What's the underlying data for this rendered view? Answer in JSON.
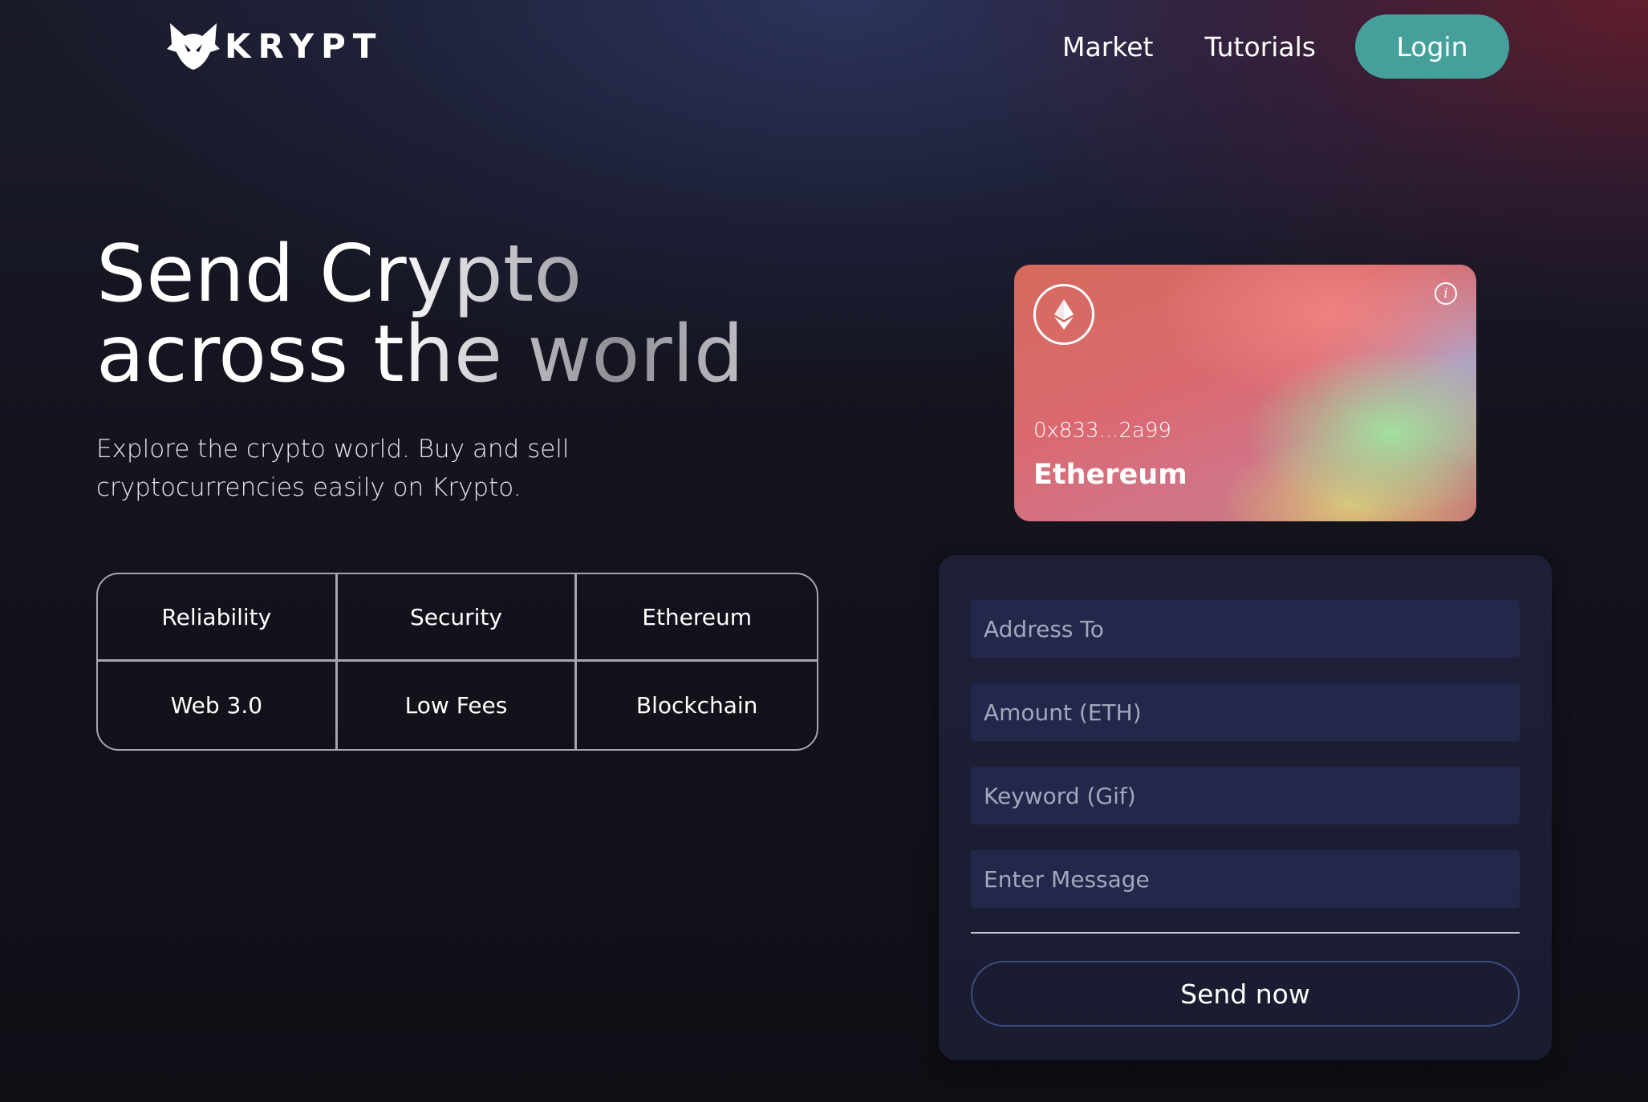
{
  "nav": {
    "logo_text": "KRYPT",
    "links": [
      "Market",
      "Tutorials"
    ],
    "login_label": "Login"
  },
  "hero": {
    "title_line1": "Send Crypto",
    "title_line2": "across the world",
    "subtitle": "Explore the crypto world. Buy and sell cryptocurrencies easily on Krypto."
  },
  "features": [
    "Reliability",
    "Security",
    "Ethereum",
    "Web 3.0",
    "Low Fees",
    "Blockchain"
  ],
  "card": {
    "address": "0x833...2a99",
    "network": "Ethereum",
    "icon": "ethereum-icon"
  },
  "form": {
    "address_placeholder": "Address To",
    "amount_placeholder": "Amount (ETH)",
    "keyword_placeholder": "Keyword (Gif)",
    "message_placeholder": "Enter Message",
    "submit_label": "Send now"
  },
  "colors": {
    "accent": "#45a09c",
    "panel": "#1d2037",
    "input_bg": "#23284a"
  }
}
